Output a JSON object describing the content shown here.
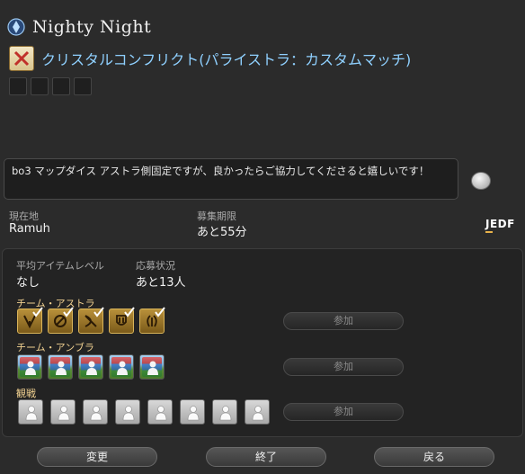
{
  "header": {
    "title": "Nighty Night"
  },
  "duty": {
    "name": "クリスタルコンフリクト(パライストラ：カスタムマッチ)"
  },
  "comment": {
    "text": "bo3 マップダイス アストラ側固定ですが、良かったらご協力してくださると嬉しいです！"
  },
  "info": {
    "location_label": "現在地",
    "location_value": "Ramuh",
    "deadline_label": "募集期限",
    "deadline_value": "あと55分",
    "lang_tag": "JEDF"
  },
  "panel": {
    "avg_item_level_label": "平均アイテムレベル",
    "avg_item_level_value": "なし",
    "application_label": "応募状況",
    "application_value": "あと13人",
    "team_astra_label": "チーム・アストラ",
    "team_umbra_label": "チーム・アンブラ",
    "spectate_label": "観戦",
    "join_label": "参加"
  },
  "footer": {
    "change_label": "変更",
    "end_label": "終了",
    "back_label": "戻る"
  },
  "colors": {
    "duty_name": "#8fd0ff",
    "team_label": "#f0d090",
    "job_gold": "#d9b45a"
  },
  "icons": {
    "world": "crystal-icon",
    "duty": "crossed-swords-icon",
    "chat": "chat-bubble-icon"
  }
}
